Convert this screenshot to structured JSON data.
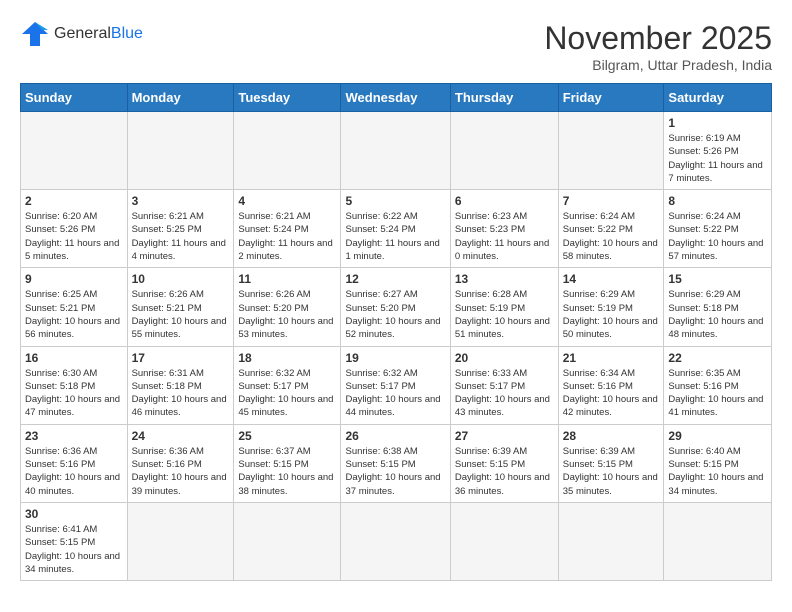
{
  "header": {
    "logo_general": "General",
    "logo_blue": "Blue",
    "month_title": "November 2025",
    "location": "Bilgram, Uttar Pradesh, India"
  },
  "weekdays": [
    "Sunday",
    "Monday",
    "Tuesday",
    "Wednesday",
    "Thursday",
    "Friday",
    "Saturday"
  ],
  "weeks": [
    [
      {
        "day": "",
        "info": ""
      },
      {
        "day": "",
        "info": ""
      },
      {
        "day": "",
        "info": ""
      },
      {
        "day": "",
        "info": ""
      },
      {
        "day": "",
        "info": ""
      },
      {
        "day": "",
        "info": ""
      },
      {
        "day": "1",
        "info": "Sunrise: 6:19 AM\nSunset: 5:26 PM\nDaylight: 11 hours and 7 minutes."
      }
    ],
    [
      {
        "day": "2",
        "info": "Sunrise: 6:20 AM\nSunset: 5:26 PM\nDaylight: 11 hours and 5 minutes."
      },
      {
        "day": "3",
        "info": "Sunrise: 6:21 AM\nSunset: 5:25 PM\nDaylight: 11 hours and 4 minutes."
      },
      {
        "day": "4",
        "info": "Sunrise: 6:21 AM\nSunset: 5:24 PM\nDaylight: 11 hours and 2 minutes."
      },
      {
        "day": "5",
        "info": "Sunrise: 6:22 AM\nSunset: 5:24 PM\nDaylight: 11 hours and 1 minute."
      },
      {
        "day": "6",
        "info": "Sunrise: 6:23 AM\nSunset: 5:23 PM\nDaylight: 11 hours and 0 minutes."
      },
      {
        "day": "7",
        "info": "Sunrise: 6:24 AM\nSunset: 5:22 PM\nDaylight: 10 hours and 58 minutes."
      },
      {
        "day": "8",
        "info": "Sunrise: 6:24 AM\nSunset: 5:22 PM\nDaylight: 10 hours and 57 minutes."
      }
    ],
    [
      {
        "day": "9",
        "info": "Sunrise: 6:25 AM\nSunset: 5:21 PM\nDaylight: 10 hours and 56 minutes."
      },
      {
        "day": "10",
        "info": "Sunrise: 6:26 AM\nSunset: 5:21 PM\nDaylight: 10 hours and 55 minutes."
      },
      {
        "day": "11",
        "info": "Sunrise: 6:26 AM\nSunset: 5:20 PM\nDaylight: 10 hours and 53 minutes."
      },
      {
        "day": "12",
        "info": "Sunrise: 6:27 AM\nSunset: 5:20 PM\nDaylight: 10 hours and 52 minutes."
      },
      {
        "day": "13",
        "info": "Sunrise: 6:28 AM\nSunset: 5:19 PM\nDaylight: 10 hours and 51 minutes."
      },
      {
        "day": "14",
        "info": "Sunrise: 6:29 AM\nSunset: 5:19 PM\nDaylight: 10 hours and 50 minutes."
      },
      {
        "day": "15",
        "info": "Sunrise: 6:29 AM\nSunset: 5:18 PM\nDaylight: 10 hours and 48 minutes."
      }
    ],
    [
      {
        "day": "16",
        "info": "Sunrise: 6:30 AM\nSunset: 5:18 PM\nDaylight: 10 hours and 47 minutes."
      },
      {
        "day": "17",
        "info": "Sunrise: 6:31 AM\nSunset: 5:18 PM\nDaylight: 10 hours and 46 minutes."
      },
      {
        "day": "18",
        "info": "Sunrise: 6:32 AM\nSunset: 5:17 PM\nDaylight: 10 hours and 45 minutes."
      },
      {
        "day": "19",
        "info": "Sunrise: 6:32 AM\nSunset: 5:17 PM\nDaylight: 10 hours and 44 minutes."
      },
      {
        "day": "20",
        "info": "Sunrise: 6:33 AM\nSunset: 5:17 PM\nDaylight: 10 hours and 43 minutes."
      },
      {
        "day": "21",
        "info": "Sunrise: 6:34 AM\nSunset: 5:16 PM\nDaylight: 10 hours and 42 minutes."
      },
      {
        "day": "22",
        "info": "Sunrise: 6:35 AM\nSunset: 5:16 PM\nDaylight: 10 hours and 41 minutes."
      }
    ],
    [
      {
        "day": "23",
        "info": "Sunrise: 6:36 AM\nSunset: 5:16 PM\nDaylight: 10 hours and 40 minutes."
      },
      {
        "day": "24",
        "info": "Sunrise: 6:36 AM\nSunset: 5:16 PM\nDaylight: 10 hours and 39 minutes."
      },
      {
        "day": "25",
        "info": "Sunrise: 6:37 AM\nSunset: 5:15 PM\nDaylight: 10 hours and 38 minutes."
      },
      {
        "day": "26",
        "info": "Sunrise: 6:38 AM\nSunset: 5:15 PM\nDaylight: 10 hours and 37 minutes."
      },
      {
        "day": "27",
        "info": "Sunrise: 6:39 AM\nSunset: 5:15 PM\nDaylight: 10 hours and 36 minutes."
      },
      {
        "day": "28",
        "info": "Sunrise: 6:39 AM\nSunset: 5:15 PM\nDaylight: 10 hours and 35 minutes."
      },
      {
        "day": "29",
        "info": "Sunrise: 6:40 AM\nSunset: 5:15 PM\nDaylight: 10 hours and 34 minutes."
      }
    ],
    [
      {
        "day": "30",
        "info": "Sunrise: 6:41 AM\nSunset: 5:15 PM\nDaylight: 10 hours and 34 minutes."
      },
      {
        "day": "",
        "info": ""
      },
      {
        "day": "",
        "info": ""
      },
      {
        "day": "",
        "info": ""
      },
      {
        "day": "",
        "info": ""
      },
      {
        "day": "",
        "info": ""
      },
      {
        "day": "",
        "info": ""
      }
    ]
  ]
}
